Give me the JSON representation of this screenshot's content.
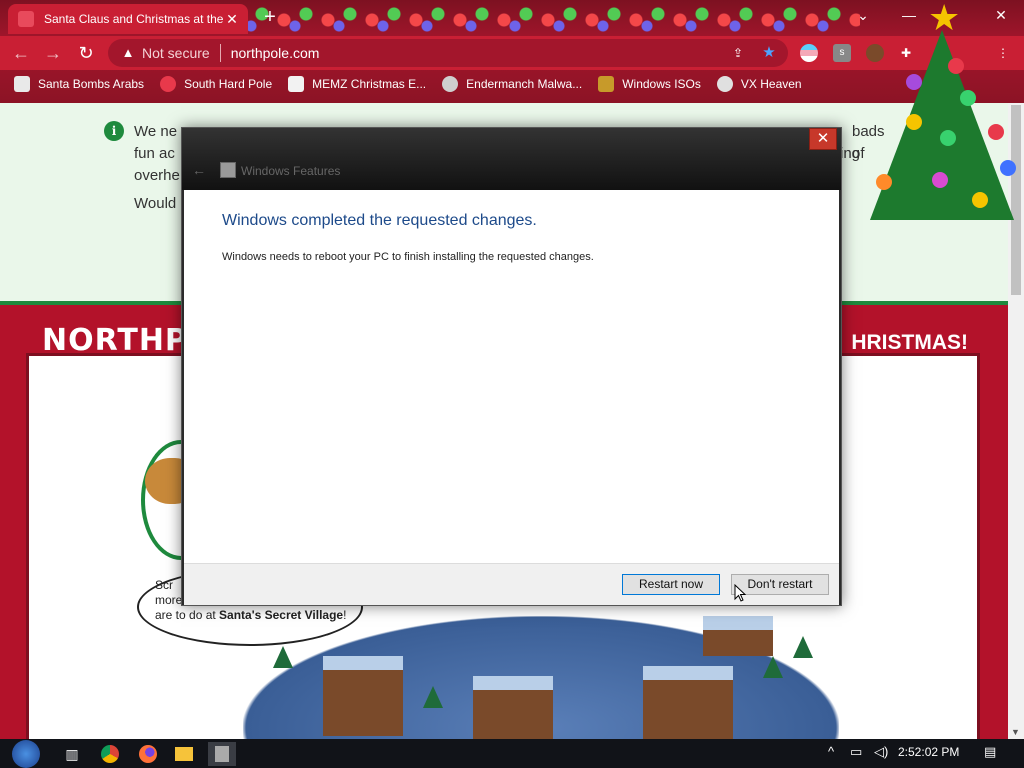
{
  "browser": {
    "tab_title": "Santa Claus and Christmas at the",
    "tab_close": "✕",
    "new_tab": "+",
    "not_secure": "Not secure",
    "url": "northpole.com",
    "bookmarks": [
      {
        "label": "Santa Bombs Arabs",
        "color": "#e9e9e9"
      },
      {
        "label": "South Hard Pole",
        "color": "#e8394b"
      },
      {
        "label": "MEMZ Christmas E...",
        "color": "#f2f2f2"
      },
      {
        "label": "Endermanch Malwa...",
        "color": "#cfcfcf"
      },
      {
        "label": "Windows ISOs",
        "color": "#c79a2a"
      },
      {
        "label": "VX Heaven",
        "color": "#e0e0e0"
      }
    ]
  },
  "page": {
    "notice_line1": "We ne",
    "notice_line1_end": "bads of",
    "notice_line2": "fun ac",
    "notice_line2_end": "ing",
    "notice_line3": "overhe",
    "notice_line4": "Would",
    "banner_left": "NORTHP",
    "banner_right": "HRISTMAS!",
    "bubble_l1": "Scr",
    "bubble_l2": "more",
    "bubble_l3_pre": "are to do at ",
    "bubble_l3_bold": "Santa's Secret Village",
    "bubble_l3_post": "!"
  },
  "dialog": {
    "window_name": "Windows Features",
    "close": "✕",
    "heading": "Windows completed the requested changes.",
    "message": "Windows needs to reboot your PC to finish installing the requested changes.",
    "restart_now": "Restart now",
    "dont_restart": "Don't restart"
  },
  "taskbar": {
    "clock": "2:52:02 PM"
  },
  "colors": {
    "brand_red": "#c91f34",
    "notice_green": "#1e8a3d",
    "dialog_heading": "#1d4a8a"
  }
}
